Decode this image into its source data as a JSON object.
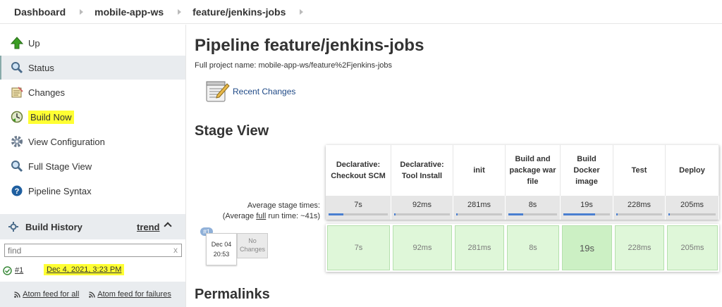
{
  "breadcrumb": {
    "items": [
      "Dashboard",
      "mobile-app-ws",
      "feature/jenkins-jobs"
    ]
  },
  "sidebar": {
    "tasks": [
      {
        "label": "Up",
        "icon": "up-arrow-icon"
      },
      {
        "label": "Status",
        "icon": "magnifier-icon"
      },
      {
        "label": "Changes",
        "icon": "notepad-icon"
      },
      {
        "label": "Build Now",
        "icon": "build-clock-icon"
      },
      {
        "label": "View Configuration",
        "icon": "gear-icon"
      },
      {
        "label": "Full Stage View",
        "icon": "magnifier-icon"
      },
      {
        "label": "Pipeline Syntax",
        "icon": "help-icon"
      }
    ],
    "build_history": {
      "title": "Build History",
      "trend": "trend",
      "find_placeholder": "find",
      "find_clear": "x",
      "builds": [
        {
          "number": "#1",
          "date": "Dec 4, 2021, 3:23 PM",
          "status": "success"
        }
      ],
      "feeds": {
        "all": "Atom feed for all",
        "failures": "Atom feed for failures"
      }
    }
  },
  "main": {
    "title": "Pipeline feature/jenkins-jobs",
    "full_name": "Full project name: mobile-app-ws/feature%2Fjenkins-jobs",
    "recent_changes": "Recent Changes",
    "stage_view_heading": "Stage View",
    "permalinks_heading": "Permalinks",
    "stage_view": {
      "avg_label_line1": "Average stage times:",
      "avg_label_pre": "(Average ",
      "avg_label_full": "full",
      "avg_label_post": " run time: ~41s)",
      "stages": [
        {
          "name": "Declarative: Checkout SCM",
          "avg": "7s",
          "avg_fraction": 0.25,
          "run": "7s"
        },
        {
          "name": "Declarative: Tool Install",
          "avg": "92ms",
          "avg_fraction": 0.02,
          "run": "92ms"
        },
        {
          "name": "init",
          "avg": "281ms",
          "avg_fraction": 0.03,
          "run": "281ms"
        },
        {
          "name": "Build and package war file",
          "avg": "8s",
          "avg_fraction": 0.3,
          "run": "8s"
        },
        {
          "name": "Build Docker image",
          "avg": "19s",
          "avg_fraction": 0.68,
          "run": "19s"
        },
        {
          "name": "Test",
          "avg": "228ms",
          "avg_fraction": 0.03,
          "run": "228ms"
        },
        {
          "name": "Deploy",
          "avg": "205ms",
          "avg_fraction": 0.03,
          "run": "205ms"
        }
      ],
      "run": {
        "badge": "#1",
        "date": "Dec 04",
        "time": "20:53",
        "changes": "No Changes"
      }
    }
  },
  "colors": {
    "highlight": "#ffff33",
    "stage_success": "#dff7d9",
    "bar_fill": "#4a7fd0"
  }
}
